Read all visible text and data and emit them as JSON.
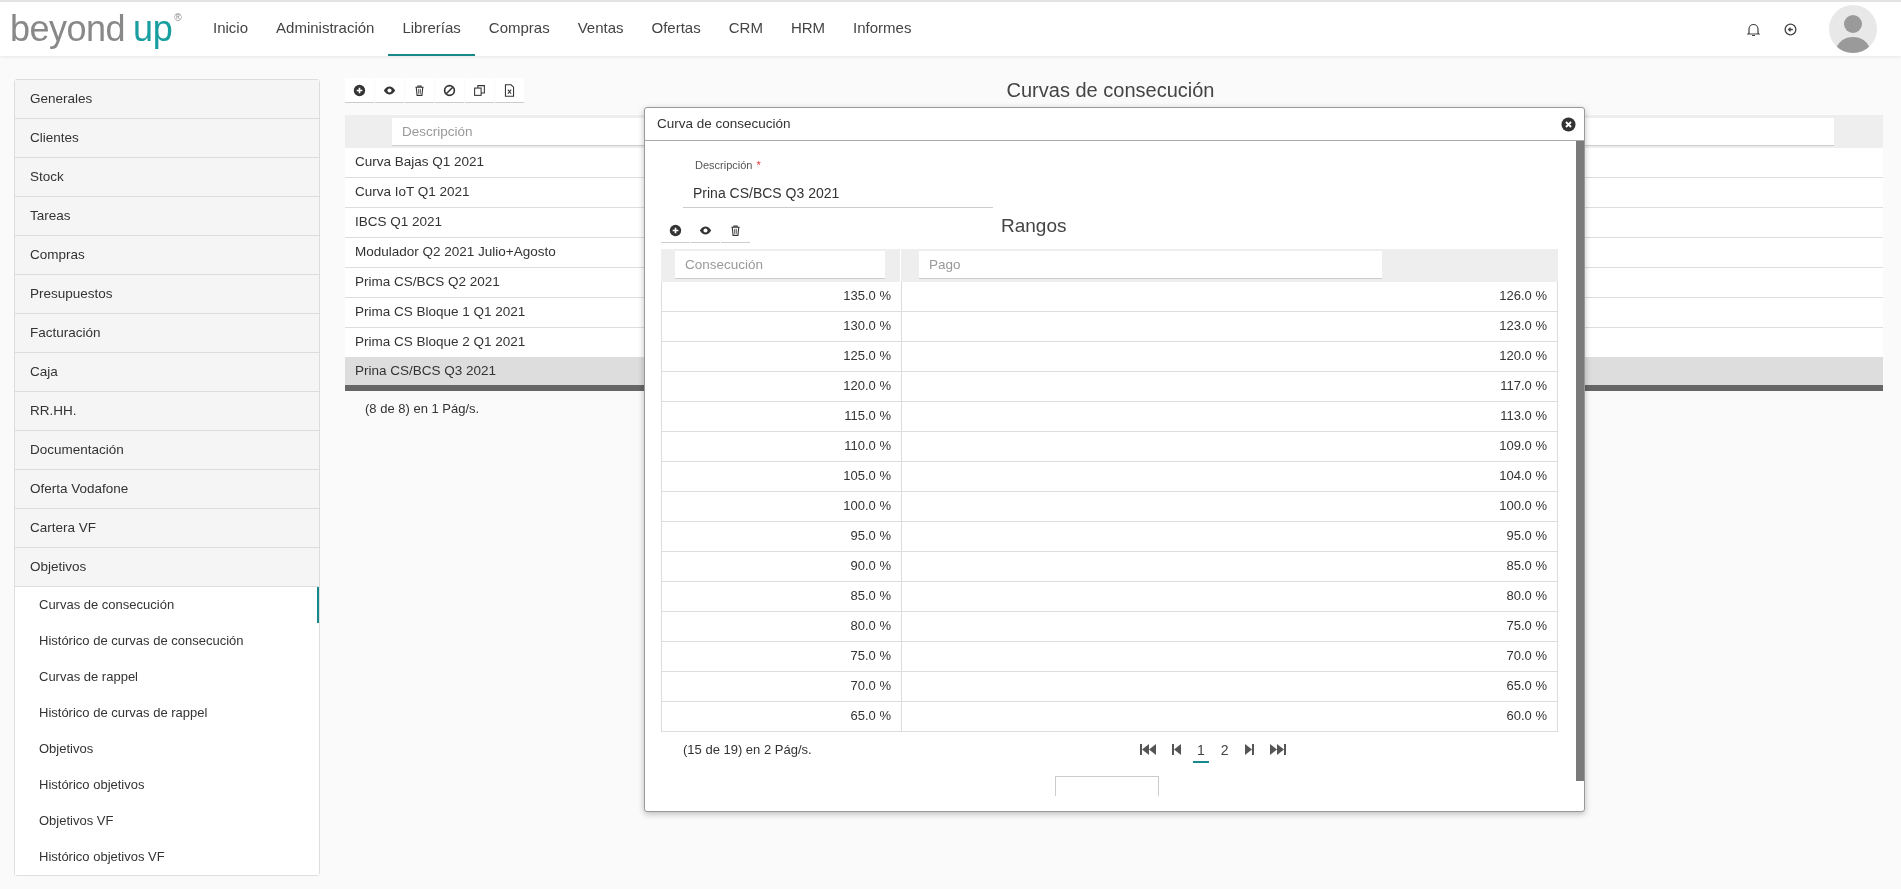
{
  "brand": {
    "word1": "beyond",
    "word2": "up",
    "mark": "®"
  },
  "nav": [
    {
      "label": "Inicio",
      "selected": false
    },
    {
      "label": "Administración",
      "selected": false
    },
    {
      "label": "Librerías",
      "selected": true
    },
    {
      "label": "Compras",
      "selected": false
    },
    {
      "label": "Ventas",
      "selected": false
    },
    {
      "label": "Ofertas",
      "selected": false
    },
    {
      "label": "CRM",
      "selected": false
    },
    {
      "label": "HRM",
      "selected": false
    },
    {
      "label": "Informes",
      "selected": false
    }
  ],
  "sidebar": {
    "items": [
      {
        "label": "Generales"
      },
      {
        "label": "Clientes"
      },
      {
        "label": "Stock"
      },
      {
        "label": "Tareas"
      },
      {
        "label": "Compras"
      },
      {
        "label": "Presupuestos"
      },
      {
        "label": "Facturación"
      },
      {
        "label": "Caja"
      },
      {
        "label": "RR.HH."
      },
      {
        "label": "Documentación"
      },
      {
        "label": "Oferta Vodafone"
      },
      {
        "label": "Cartera VF"
      },
      {
        "label": "Objetivos",
        "expanded": true,
        "children": [
          {
            "label": "Curvas de consecución",
            "selected": true
          },
          {
            "label": "Histórico de curvas de consecución",
            "selected": false
          },
          {
            "label": "Curvas de rappel",
            "selected": false
          },
          {
            "label": "Histórico de curvas de rappel",
            "selected": false
          },
          {
            "label": "Objetivos",
            "selected": false
          },
          {
            "label": "Histórico objetivos",
            "selected": false
          },
          {
            "label": "Objetivos VF",
            "selected": false
          },
          {
            "label": "Histórico objetivos VF",
            "selected": false
          }
        ]
      }
    ]
  },
  "main": {
    "title": "Curvas de consecución",
    "filter": {
      "placeholder": "Descripción"
    },
    "rows": [
      {
        "text": "Curva Bajas Q1 2021",
        "selected": false
      },
      {
        "text": "Curva IoT Q1 2021",
        "selected": false
      },
      {
        "text": "IBCS Q1 2021",
        "selected": false
      },
      {
        "text": "Modulador Q2 2021 Julio+Agosto",
        "selected": false
      },
      {
        "text": "Prima CS/BCS Q2 2021",
        "selected": false
      },
      {
        "text": "Prima CS Bloque 1 Q1 2021",
        "selected": false
      },
      {
        "text": "Prima CS Bloque 2 Q1 2021",
        "selected": false
      },
      {
        "text": "Prina CS/BCS Q3 2021",
        "selected": true
      }
    ],
    "footer": "(8 de 8) en 1 Pág/s."
  },
  "modal": {
    "title": "Curva de consecución",
    "field": {
      "label": "Descripción",
      "required_mark": "*",
      "value": "Prina CS/BCS Q3 2021"
    },
    "ranges_title": "Rangos",
    "filters": [
      {
        "placeholder": "Consecución"
      },
      {
        "placeholder": "Pago"
      }
    ],
    "rows": [
      [
        "135.0 %",
        "126.0 %"
      ],
      [
        "130.0 %",
        "123.0 %"
      ],
      [
        "125.0 %",
        "120.0 %"
      ],
      [
        "120.0 %",
        "117.0 %"
      ],
      [
        "115.0 %",
        "113.0 %"
      ],
      [
        "110.0 %",
        "109.0 %"
      ],
      [
        "105.0 %",
        "104.0 %"
      ],
      [
        "100.0 %",
        "100.0 %"
      ],
      [
        "95.0 %",
        "95.0 %"
      ],
      [
        "90.0 %",
        "85.0 %"
      ],
      [
        "85.0 %",
        "80.0 %"
      ],
      [
        "80.0 %",
        "75.0 %"
      ],
      [
        "75.0 %",
        "70.0 %"
      ],
      [
        "70.0 %",
        "65.0 %"
      ],
      [
        "65.0 %",
        "60.0 %"
      ]
    ],
    "footer": "(15 de 19) en 2 Pág/s.",
    "pages": [
      {
        "label": "1",
        "selected": true
      },
      {
        "label": "2",
        "selected": false
      }
    ]
  }
}
